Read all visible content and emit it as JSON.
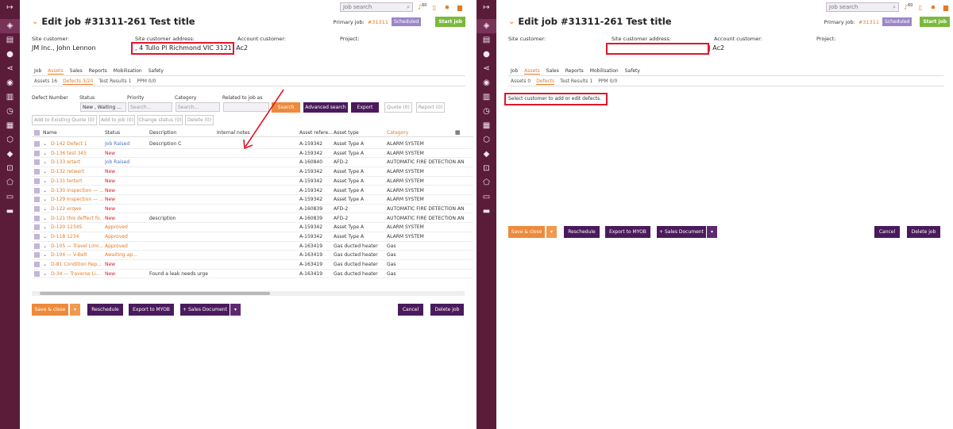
{
  "colors": {
    "sidebar": "#5b1c3a",
    "accent": "#e07b2a",
    "purple": "#4a1a5c",
    "scheduled": "#9d86c8",
    "start": "#7bb93d",
    "highlight": "#e0162b"
  },
  "topbar": {
    "search_placeholder": "Job search",
    "notif_count": "60"
  },
  "header": {
    "title": "Edit job #31311-261 Test title",
    "primary_label": "Primary job:",
    "primary_link": "#31311",
    "scheduled": "Scheduled",
    "start_job": "Start job"
  },
  "fields": {
    "site_customer_label": "Site customer:",
    "site_customer_value": "JM Inc., John Lennon",
    "site_address_label": "Site customer address:",
    "site_address_value": ", 4 Tullo Pl Richmond VIC 3121",
    "account_customer_label": "Account customer:",
    "account_customer_value": "| Ac2",
    "project_label": "Project:"
  },
  "tabs_main": [
    "Job",
    "Assets",
    "Sales",
    "Reports",
    "Mobilisation",
    "Safety"
  ],
  "tabs_sub": [
    "Assets 16",
    "Defects 3/20",
    "Test Results 1",
    "PPM 0/0"
  ],
  "tabs_sub_right": [
    "Assets 0",
    "Defects",
    "Test Results 1",
    "PPM 0/0"
  ],
  "filters": {
    "defect_number": "Defect Number",
    "status": "Status",
    "priority": "Priority",
    "category": "Category",
    "related": "Related to job as",
    "status_value": "New , Waiting ...",
    "search_ph": "Search...",
    "search_btn": "Search",
    "advanced_btn": "Advanced search",
    "export_btn": "Export",
    "quote_btn": "Quote (0)",
    "report_btn": "Report (0)",
    "add_quote": "Add to Existing Quote (0)",
    "add_job": "Add to Job (0)",
    "change_status": "Change status (0)",
    "delete": "Delete (0)"
  },
  "table": {
    "columns": [
      "Name",
      "Status",
      "Description",
      "Internal notes",
      "Asset refere...",
      "Asset type",
      "Category"
    ],
    "rows": [
      {
        "name": "D-142 Defect 1",
        "status": "Job Raised",
        "desc": "Description C",
        "ref": "A-159342",
        "type": "Asset Type A",
        "cat": "ALARM SYSTEM",
        "sc": "status-blue"
      },
      {
        "name": "D-136 test 345",
        "status": "New",
        "desc": "",
        "ref": "A-159342",
        "type": "Asset Type A",
        "cat": "ALARM SYSTEM",
        "sc": "status-red"
      },
      {
        "name": "D-133 ertert",
        "status": "Job Raised",
        "desc": "",
        "ref": "A-160840",
        "type": "AFD-2",
        "cat": "AUTOMATIC FIRE DETECTION AN",
        "sc": "status-blue"
      },
      {
        "name": "D-132 retwert",
        "status": "New",
        "desc": "",
        "ref": "A-159342",
        "type": "Asset Type A",
        "cat": "ALARM SYSTEM",
        "sc": "status-red"
      },
      {
        "name": "D-131 tertert",
        "status": "New",
        "desc": "",
        "ref": "A-159342",
        "type": "Asset Type A",
        "cat": "ALARM SYSTEM",
        "sc": "status-red"
      },
      {
        "name": "D-130 Inspection — ...",
        "status": "New",
        "desc": "",
        "ref": "A-159342",
        "type": "Asset Type A",
        "cat": "ALARM SYSTEM",
        "sc": "status-red"
      },
      {
        "name": "D-129 Inspection — ...",
        "status": "New",
        "desc": "",
        "ref": "A-159342",
        "type": "Asset Type A",
        "cat": "ALARM SYSTEM",
        "sc": "status-red"
      },
      {
        "name": "D-122 erqwe",
        "status": "New",
        "desc": "",
        "ref": "A-160839",
        "type": "AFD-2",
        "cat": "AUTOMATIC FIRE DETECTION AN",
        "sc": "status-red"
      },
      {
        "name": "D-121 this deffect fo...",
        "status": "New",
        "desc": "description",
        "ref": "A-160839",
        "type": "AFD-2",
        "cat": "AUTOMATIC FIRE DETECTION AN",
        "sc": "status-red"
      },
      {
        "name": "D-120 12345",
        "status": "Approved",
        "desc": "",
        "ref": "A-159342",
        "type": "Asset Type A",
        "cat": "ALARM SYSTEM",
        "sc": "status-orange"
      },
      {
        "name": "D-118 1234",
        "status": "Approved",
        "desc": "",
        "ref": "A-159342",
        "type": "Asset Type A",
        "cat": "ALARM SYSTEM",
        "sc": "status-orange"
      },
      {
        "name": "D-105 — Travel Limi...",
        "status": "Approved",
        "desc": "",
        "ref": "A-163419",
        "type": "Gas ducted heater",
        "cat": "Gas",
        "sc": "status-orange"
      },
      {
        "name": "D-104 — V-Belt",
        "status": "Awaiting ap...",
        "desc": "",
        "ref": "A-163419",
        "type": "Gas ducted heater",
        "cat": "Gas",
        "sc": "status-orange"
      },
      {
        "name": "D-81 Condition Rep...",
        "status": "New",
        "desc": "",
        "ref": "A-163419",
        "type": "Gas ducted heater",
        "cat": "Gas",
        "sc": "status-red"
      },
      {
        "name": "D-34 — Traverse Li...",
        "status": "New",
        "desc": "Found a leak needs urge",
        "ref": "A-163419",
        "type": "Gas ducted heater",
        "cat": "Gas",
        "sc": "status-red"
      }
    ]
  },
  "footer": {
    "save_close": "Save & close",
    "reschedule": "Reschedule",
    "export_myob": "Export to MYOB",
    "sales_doc": "+ Sales Document",
    "cancel": "Cancel",
    "delete_job": "Delete job"
  },
  "right": {
    "notice": "Select customer to add or edit defects.",
    "account_value": "| Ac2"
  }
}
